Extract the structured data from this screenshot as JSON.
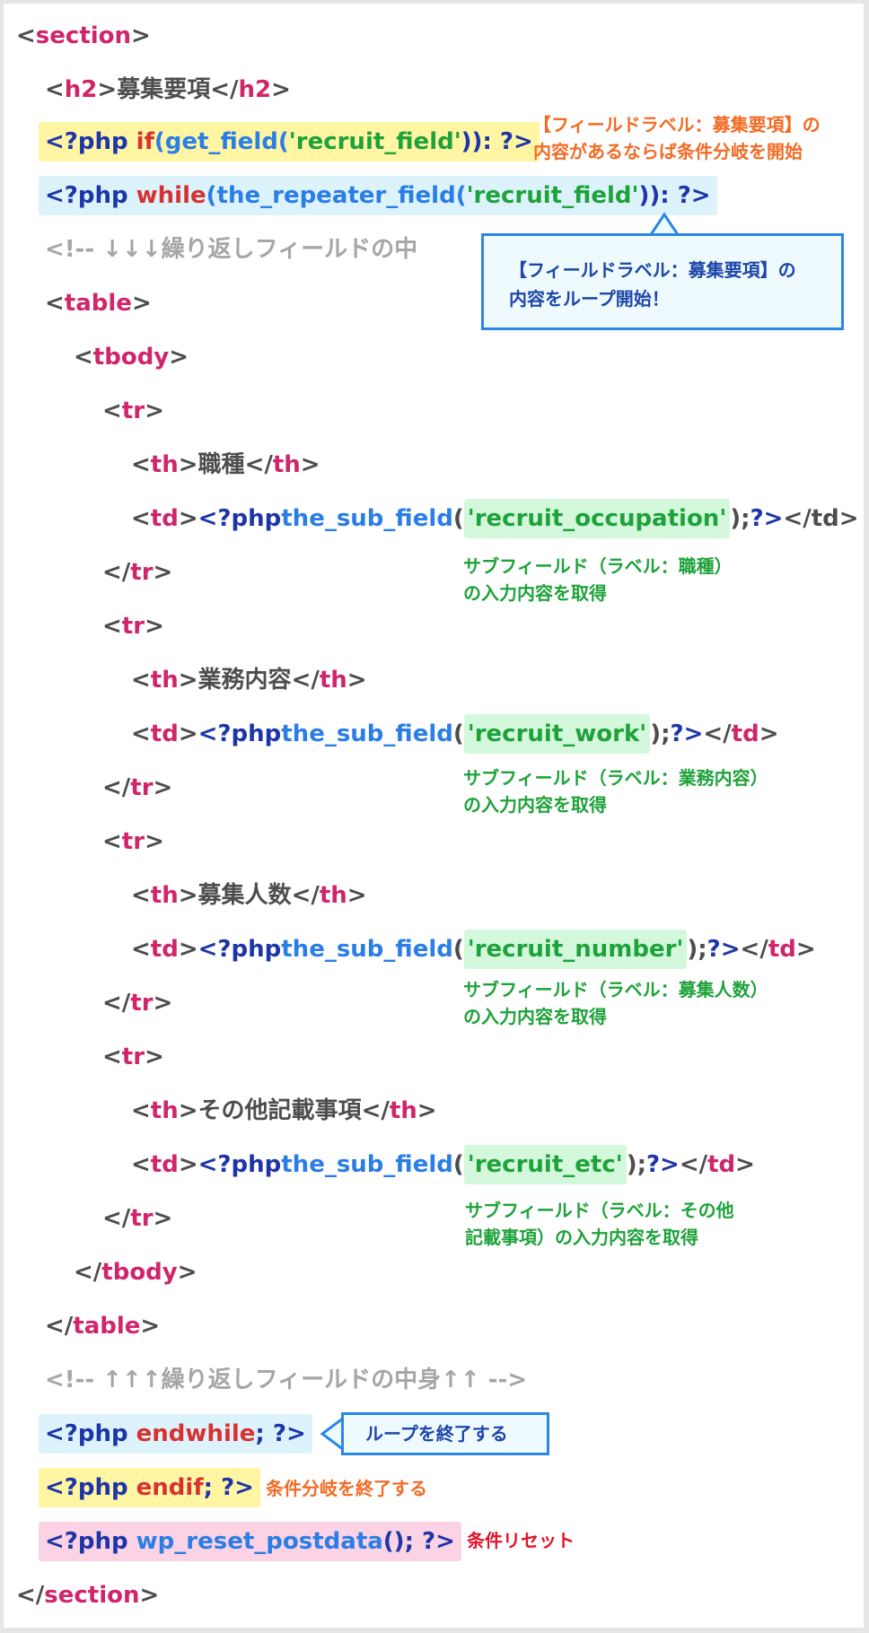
{
  "code": {
    "l1": {
      "lt": "<",
      "tag": "section",
      "gt": ">"
    },
    "l2": {
      "lt": "<",
      "tag": "h2",
      "gt": ">",
      "text": "募集要項",
      "clt": "</",
      "ctag": "h2",
      "cgt": ">"
    },
    "l3": {
      "open": "<?php ",
      "ctl": "if",
      "paren1": "(",
      "fn": "get_field",
      "paren2": "(",
      "str": "'recruit_field'",
      "close": ")): ",
      "end": "?>"
    },
    "l4": {
      "open": "<?php ",
      "ctl": "while",
      "paren1": "(",
      "fn": "the_repeater_field",
      "paren2": "(",
      "str": "'recruit_field'",
      "close": ")): ",
      "end": "?>"
    },
    "l5": {
      "comment": "<!-- ↓↓↓繰り返しフィールドの中"
    },
    "l6": {
      "lt": "<",
      "tag": "table",
      "gt": ">"
    },
    "l7": {
      "lt": "<",
      "tag": "tbody",
      "gt": ">"
    },
    "l8": {
      "lt": "<",
      "tag": "tr",
      "gt": ">"
    },
    "l9": {
      "lt": "<",
      "tag": "th",
      "gt": ">",
      "text": "職種",
      "clt": "</",
      "ctag": "th",
      "cgt": ">"
    },
    "l10": {
      "lt": "<",
      "tag": "td",
      "gt": ">",
      "php": "<?php ",
      "fn": "the_sub_field",
      "paren": "(",
      "str": "'recruit_occupation'",
      "semi": "); ",
      "end": "?>",
      "tail": "</td>"
    },
    "l11": {
      "lt": "</",
      "tag": "tr",
      "gt": ">"
    },
    "l12": {
      "lt": "<",
      "tag": "tr",
      "gt": ">"
    },
    "l13": {
      "lt": "<",
      "tag": "th",
      "gt": ">",
      "text": "業務内容",
      "clt": "</",
      "ctag": "th",
      "cgt": ">"
    },
    "l14": {
      "lt": "<",
      "tag": "td",
      "gt": ">",
      "php": "<?php ",
      "fn": "the_sub_field",
      "paren": "(",
      "str": "'recruit_work'",
      "semi": "); ",
      "end": "?>",
      "clt": "</",
      "ctag": "td",
      "cgt": ">"
    },
    "l15": {
      "lt": "</",
      "tag": "tr",
      "gt": ">"
    },
    "l16": {
      "lt": "<",
      "tag": "tr",
      "gt": ">"
    },
    "l17": {
      "lt": "<",
      "tag": "th",
      "gt": ">",
      "text": "募集人数",
      "clt": "</",
      "ctag": "th",
      "cgt": ">"
    },
    "l18": {
      "lt": "<",
      "tag": "td",
      "gt": ">",
      "php": "<?php ",
      "fn": "the_sub_field",
      "paren": "(",
      "str": "'recruit_number'",
      "semi": "); ",
      "end": "?>",
      "clt": "</",
      "ctag": "td",
      "cgt": ">"
    },
    "l19": {
      "lt": "</",
      "tag": "tr",
      "gt": ">"
    },
    "l20": {
      "lt": "<",
      "tag": "tr",
      "gt": ">"
    },
    "l21": {
      "lt": "<",
      "tag": "th",
      "gt": ">",
      "text": "その他記載事項",
      "clt": "</",
      "ctag": "th",
      "cgt": ">"
    },
    "l22": {
      "lt": "<",
      "tag": "td",
      "gt": ">",
      "php": "<?php ",
      "fn": "the_sub_field",
      "paren": "(",
      "str": "'recruit_etc'",
      "semi": "); ",
      "end": "?>",
      "clt": "</",
      "ctag": "td",
      "cgt": ">"
    },
    "l23": {
      "lt": "</",
      "tag": "tr",
      "gt": ">"
    },
    "l24": {
      "lt": "</",
      "tag": "tbody",
      "gt": ">"
    },
    "l25": {
      "lt": "</",
      "tag": "table",
      "gt": ">"
    },
    "l26": {
      "comment": "<!-- ↑↑↑繰り返しフィールドの中身↑↑ -->"
    },
    "l27": {
      "open": "<?php ",
      "ctl": "endwhile",
      "semi": "; ",
      "end": "?>"
    },
    "l28": {
      "open": "<?php ",
      "ctl": "endif",
      "semi": "; ",
      "end": "?>"
    },
    "l29": {
      "open": "<?php ",
      "fn": "wp_reset_postdata",
      "paren": "(); ",
      "end": "?>"
    },
    "l30": {
      "lt": "</",
      "tag": "section",
      "gt": ">"
    }
  },
  "annotations": {
    "if_note": [
      "【フィールドラベル：募集要項】の",
      "内容があるならば条件分岐を開始"
    ],
    "loop_callout": [
      "【フィールドラベル：募集要項】の",
      "内容をループ開始！"
    ],
    "occupation_note": [
      "サブフィールド（ラベル：職種）",
      "の入力内容を取得"
    ],
    "work_note": [
      "サブフィールド（ラベル：業務内容）",
      "の入力内容を取得"
    ],
    "number_note": [
      "サブフィールド（ラベル：募集人数）",
      "の入力内容を取得"
    ],
    "etc_note": [
      "サブフィールド（ラベル：その他",
      "記載事項）の入力内容を取得"
    ],
    "endwhile_callout": "ループを終了する",
    "endif_note": "条件分岐を終了する",
    "reset_note": "条件リセット"
  },
  "colors": {
    "tag": "#d0256b",
    "php_keyword": "#1d35a8",
    "function": "#2a7ee6",
    "string": "#1ea23a",
    "control": "#d63231",
    "comment": "#a6a6a6",
    "highlight_yellow": "#fff5a3",
    "highlight_blue": "#ddf3fb",
    "highlight_pink": "#fbd3e5",
    "highlight_green": "#d4f8dc",
    "note_orange": "#f26b25",
    "callout_border": "#2a87e8"
  }
}
